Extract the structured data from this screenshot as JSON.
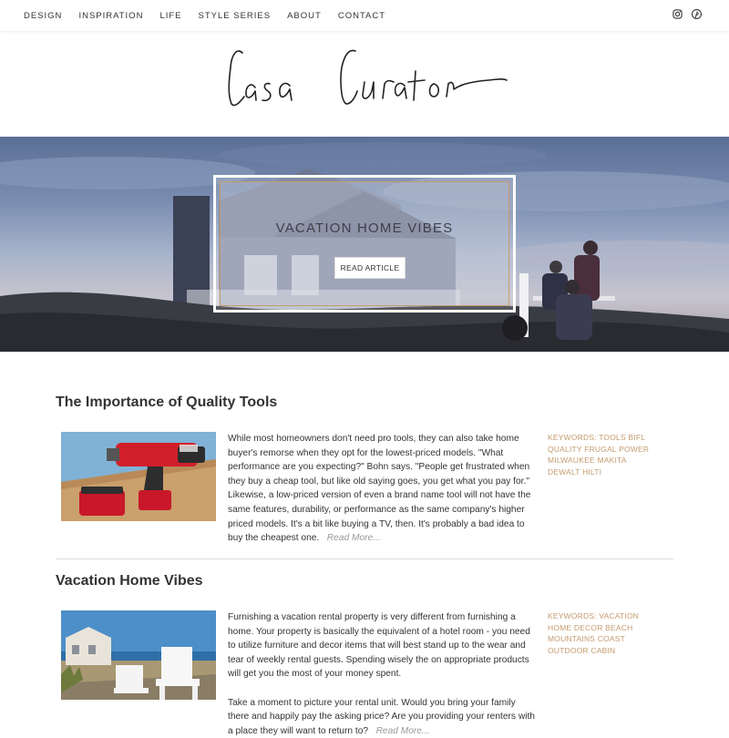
{
  "nav": {
    "items": [
      "DESIGN",
      "INSPIRATION",
      "LIFE",
      "STYLE SERIES",
      "ABOUT",
      "CONTACT"
    ],
    "social": [
      "instagram-icon",
      "pinterest-icon"
    ]
  },
  "site": {
    "logo_text": "Casa Curator"
  },
  "hero": {
    "title": "VACATION HOME VIBES",
    "button_label": "READ ARTICLE"
  },
  "articles": [
    {
      "title": "The Importance of Quality Tools",
      "paragraphs": [
        "While most homeowners don't need pro tools, they can also take home buyer's remorse when they opt for the lowest-priced models. \"What performance are you expecting?\" Bohn says. \"People get frustrated when they buy a cheap tool, but like old saying goes, you get what you pay for.\" Likewise, a low-priced version of even a brand name tool will not have the same features, durability, or performance as the same company's higher priced models. It's a bit like buying a TV, then. It's probably a bad idea to buy the cheapest one."
      ],
      "read_more": "Read More...",
      "keywords_label": "KEYWORDS:",
      "keywords": [
        "TOOLS",
        "BIFL",
        "QUALITY",
        "FRUGAL",
        "POWER",
        "MILWAUKEE",
        "MAKITA",
        "DEWALT",
        "HILTI"
      ]
    },
    {
      "title": "Vacation Home Vibes",
      "paragraphs": [
        "Furnishing a vacation rental property is very different from furnishing a home. Your property is basically the equivalent of a hotel room - you need to utilize furniture and decor items that will best stand up to the wear and tear of weekly rental guests. Spending wisely the on appropriate products will get you the most of your money spent.",
        "Take a moment to picture your rental unit. Would you bring your family there and happily pay the asking price? Are you providing your renters with a place they will want to return to?"
      ],
      "read_more": "Read More...",
      "keywords_label": "KEYWORDS:",
      "keywords": [
        "VACATION",
        "HOME",
        "DECOR",
        "BEACH",
        "MOUNTAINS",
        "COAST",
        "OUTDOOR",
        "CABIN"
      ]
    }
  ],
  "colors": {
    "accent": "#c49b70",
    "text": "#333333",
    "muted": "#999999"
  }
}
